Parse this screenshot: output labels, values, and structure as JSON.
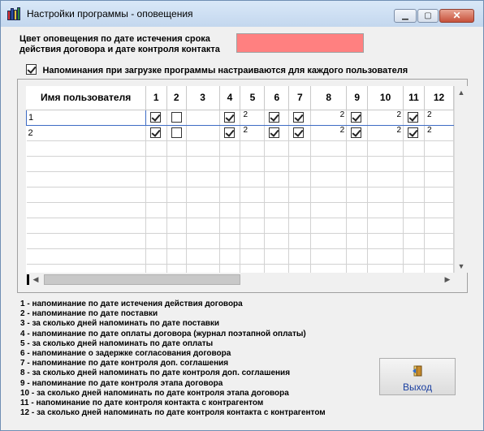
{
  "window": {
    "title": "Настройки программы - оповещения",
    "close_label": "✕",
    "min_label": "▁",
    "max_label": "▢"
  },
  "form": {
    "color_label": "Цвет оповещения по дате истечения срока действия договора и дате контроля контакта",
    "color_line1": "Цвет оповещения по дате истечения срока",
    "color_line2": "действия договора и дате контроля контакта",
    "color_value": "#ff8080",
    "per_user_checkbox": {
      "label": "Напоминания при загрузке программы настраиваются для каждого пользователя",
      "checked": true
    }
  },
  "grid": {
    "columns": [
      "Имя пользователя",
      "1",
      "2",
      "3",
      "4",
      "5",
      "6",
      "7",
      "8",
      "9",
      "10",
      "11",
      "12"
    ],
    "rows": [
      {
        "name": "1",
        "c1": true,
        "c2": false,
        "c3": "",
        "c4": true,
        "c5": "2",
        "c6": true,
        "c7": true,
        "c8": "2",
        "c9": true,
        "c10": "2",
        "c11": true,
        "c12": "2"
      },
      {
        "name": "2",
        "c1": true,
        "c2": false,
        "c3": "",
        "c4": true,
        "c5": "2",
        "c6": true,
        "c7": true,
        "c8": "2",
        "c9": true,
        "c10": "2",
        "c11": true,
        "c12": "2"
      }
    ],
    "empty_rows": 9
  },
  "legend": [
    "1 - напоминание по дате истечения действия договора",
    "2 - напоминание по дате поставки",
    "3 - за сколько дней напоминать по дате поставки",
    "4 - напоминание по дате оплаты договора (журнал поэтапной оплаты)",
    "5 - за сколько дней напоминать по дате оплаты",
    "6 - напоминание о задержке согласования договора",
    "7 - напоминание по дате контроля доп. соглашения",
    "8 - за сколько дней напоминать по дате контроля доп. соглашения",
    "9 - напоминание по дате контроля этапа договора",
    "10 - за сколько дней напоминать по дате контроля этапа договора",
    "11 - напоминание по дате контроля контакта с контрагентом",
    "12 - за сколько дней напоминать по дате контроля контакта с контрагентом"
  ],
  "buttons": {
    "exit_label": "Выход"
  }
}
